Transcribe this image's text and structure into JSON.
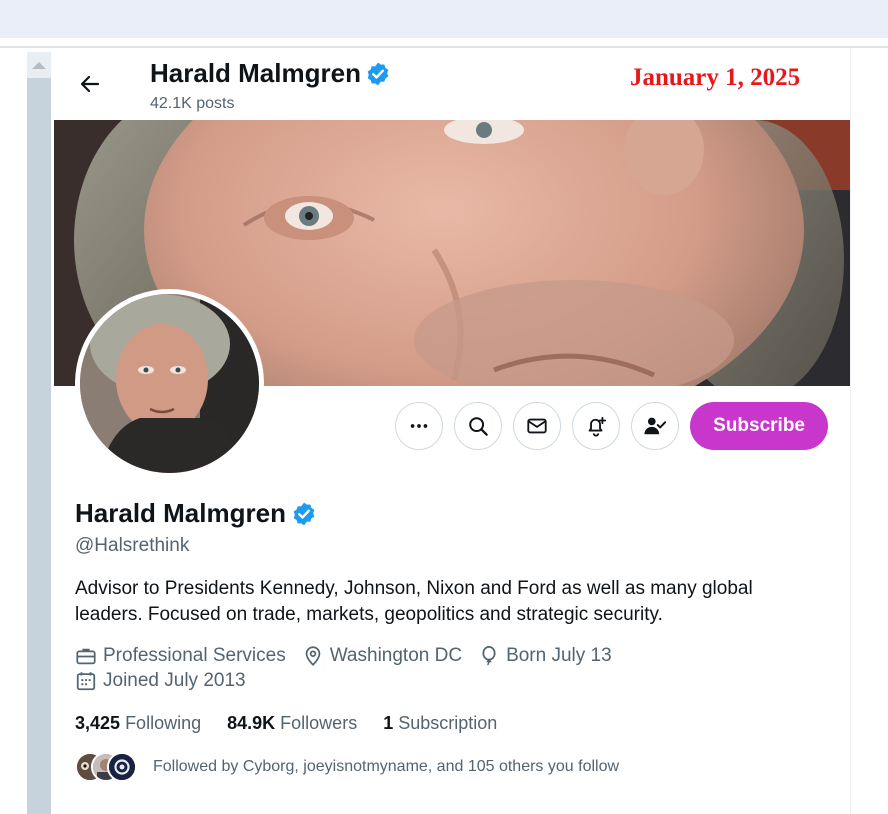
{
  "header": {
    "name": "Harald Malmgren",
    "posts": "42.1K posts"
  },
  "date_stamp": "January 1, 2025",
  "actions": {
    "subscribe_label": "Subscribe"
  },
  "profile": {
    "name": "Harald Malmgren",
    "handle": "@Halsrethink",
    "bio": "Advisor to Presidents Kennedy, Johnson, Nixon and Ford as well as many global leaders. Focused on trade, markets, geopolitics and strategic security.",
    "category": "Professional Services",
    "location": "Washington DC",
    "birthday": "Born July 13",
    "joined": "Joined July 2013"
  },
  "stats": {
    "following_count": "3,425",
    "following_label": "Following",
    "followers_count": "84.9K",
    "followers_label": "Followers",
    "subscription_count": "1",
    "subscription_label": "Subscription"
  },
  "followed_by": "Followed by Cyborg, joeyisnotmyname, and 105 others you follow",
  "icons": [
    "back-arrow-icon",
    "verified-badge-icon",
    "more-icon",
    "search-icon",
    "mail-icon",
    "notification-bell-icon",
    "following-check-icon",
    "briefcase-icon",
    "location-pin-icon",
    "balloon-icon",
    "calendar-icon"
  ],
  "colors": {
    "accent": "#c936cc",
    "verified": "#1d9bf0",
    "date_stamp": "#e8171b",
    "secondary_text": "#536471"
  }
}
